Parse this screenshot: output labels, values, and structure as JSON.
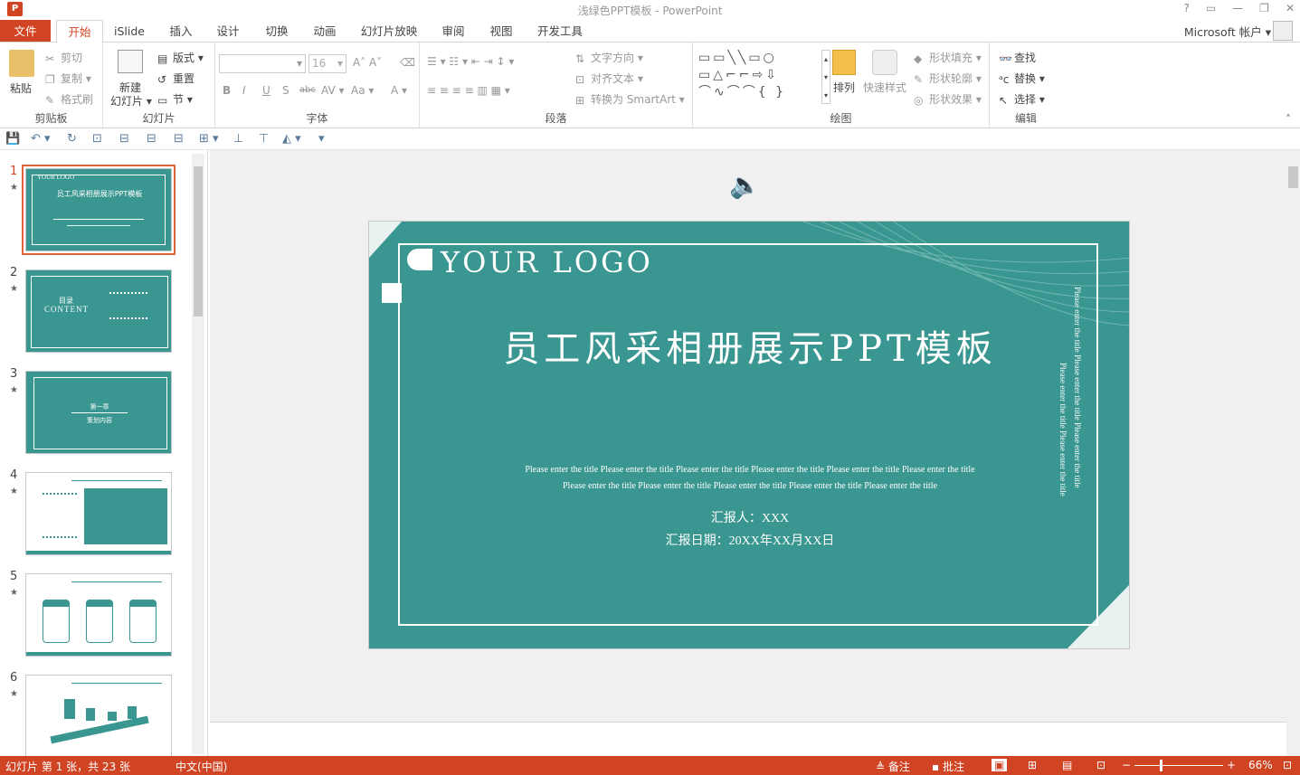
{
  "window": {
    "title": "浅绿色PPT模板 - PowerPoint",
    "help": "?",
    "restore": "▭",
    "minimize": "—",
    "maximize": "❐",
    "close": "✕"
  },
  "tabs": [
    "文件",
    "开始",
    "iSlide",
    "插入",
    "设计",
    "切换",
    "动画",
    "幻灯片放映",
    "审阅",
    "视图",
    "开发工具"
  ],
  "account": "Microsoft 帐户",
  "ribbon": {
    "clipboard": {
      "label": "剪贴板",
      "paste": "粘贴",
      "cut": "剪切",
      "copy": "复制",
      "painter": "格式刷"
    },
    "slides": {
      "label": "幻灯片",
      "new_line1": "新建",
      "new_line2": "幻灯片",
      "layout": "版式",
      "reset": "重置",
      "section": "节"
    },
    "font": {
      "label": "字体",
      "size": "16"
    },
    "paragraph": {
      "label": "段落",
      "text_dir": "文字方向",
      "align_text": "对齐文本",
      "smartart": "转换为 SmartArt"
    },
    "drawing": {
      "label": "绘图",
      "arrange": "排列",
      "quick_styles": "快速样式",
      "fill": "形状填充",
      "outline": "形状轮廓",
      "effects": "形状效果"
    },
    "editing": {
      "label": "编辑",
      "find": "查找",
      "replace": "替换",
      "select": "选择"
    }
  },
  "thumbnails": [
    {
      "num": "1",
      "star": "★"
    },
    {
      "num": "2",
      "star": "★",
      "t1": "目录",
      "t2": "CONTENT"
    },
    {
      "num": "3",
      "star": "★",
      "t1": "第一章",
      "t2": "策划内容"
    },
    {
      "num": "4",
      "star": "★"
    },
    {
      "num": "5",
      "star": "★"
    },
    {
      "num": "6",
      "star": "★"
    }
  ],
  "slide": {
    "logo": "YOUR LOGO",
    "title": "员工风采相册展示PPT模板",
    "sub1": "Please enter the title Please enter the title Please enter the title Please enter the title Please enter the title Please enter the title",
    "sub2": "Please enter the title Please enter the title Please enter the title Please enter the title Please enter the title",
    "reporter": "汇报人：XXX",
    "date": "汇报日期：20XX年XX月XX日",
    "vert1": "Please enter the title Please enter the title Please enter the title",
    "vert2": "Please enter the title Please enter the title"
  },
  "status": {
    "slide_info": "幻灯片 第 1 张，共 23 张",
    "lang": "中文(中国)",
    "notes": "备注",
    "comments": "批注",
    "zoom": "66%"
  },
  "colors": {
    "accent": "#d04423",
    "slide_bg": "#3a9690"
  }
}
